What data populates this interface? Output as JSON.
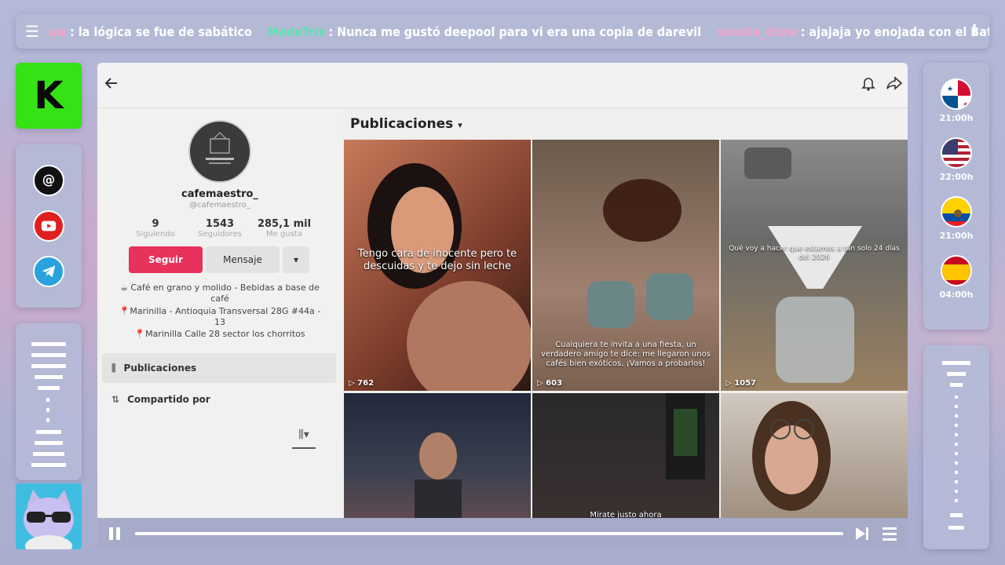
{
  "ticker": {
    "messages": [
      {
        "user": "aw",
        "text": ": la lógica se fue de sabático",
        "color": "#f2a6c8"
      },
      {
        "user": "MadeTrix",
        "text": ": Nunca me gustó deepool para vi era una copia de darevil",
        "color": "#5fe0b5"
      },
      {
        "user": "sonata_draw",
        "text": ": ajajaja yo enojada con el Batman",
        "color": "#f2a6c8"
      }
    ]
  },
  "left": {
    "brand_letter": "K",
    "socials": [
      "threads-icon",
      "youtube-icon",
      "telegram-icon"
    ]
  },
  "right": {
    "schedule": [
      {
        "flag": "panama",
        "time": "21:00h"
      },
      {
        "flag": "usa",
        "time": "22:00h"
      },
      {
        "flag": "ecuador",
        "time": "21:00h"
      },
      {
        "flag": "spain",
        "time": "04:00h"
      }
    ]
  },
  "profile": {
    "username": "cafemaestro_",
    "handle": "@cafemaestro_",
    "stats": [
      {
        "value": "9",
        "label": "Siguiendo"
      },
      {
        "value": "1543",
        "label": "Seguidores"
      },
      {
        "value": "285,1 mil",
        "label": "Me gusta"
      }
    ],
    "follow_label": "Seguir",
    "message_label": "Mensaje",
    "bio": [
      "☕ Café en grano y molido - Bebidas a base de café",
      "📍Marinilla - Antioquia Transversal 28G #44a - 13",
      "📍Marinilla Calle 28 sector los chorritos"
    ],
    "tabs": [
      {
        "icon": "grid-icon",
        "label": "Publicaciones"
      },
      {
        "icon": "repost-icon",
        "label": "Compartido por"
      }
    ]
  },
  "posts": {
    "header": "Publicaciones",
    "items": [
      {
        "caption": "Tengo cara de inocente pero te descuidas y te dejo sin leche",
        "views": "762"
      },
      {
        "caption": "Cualquiera te invita a una fiesta, un verdadero amigo te dice: me llegaron unos cafés bien exóticos, ¡Vamos a probarlos!",
        "views": "603"
      },
      {
        "caption": "Qué voy a hacer que estamos a tan solo 24 días del 2026",
        "views": "1057"
      },
      {
        "caption": "",
        "views": ""
      },
      {
        "caption": "Mirate justo ahora",
        "views": ""
      },
      {
        "caption": "",
        "views": ""
      }
    ]
  },
  "player": {
    "progress": 0.99
  }
}
